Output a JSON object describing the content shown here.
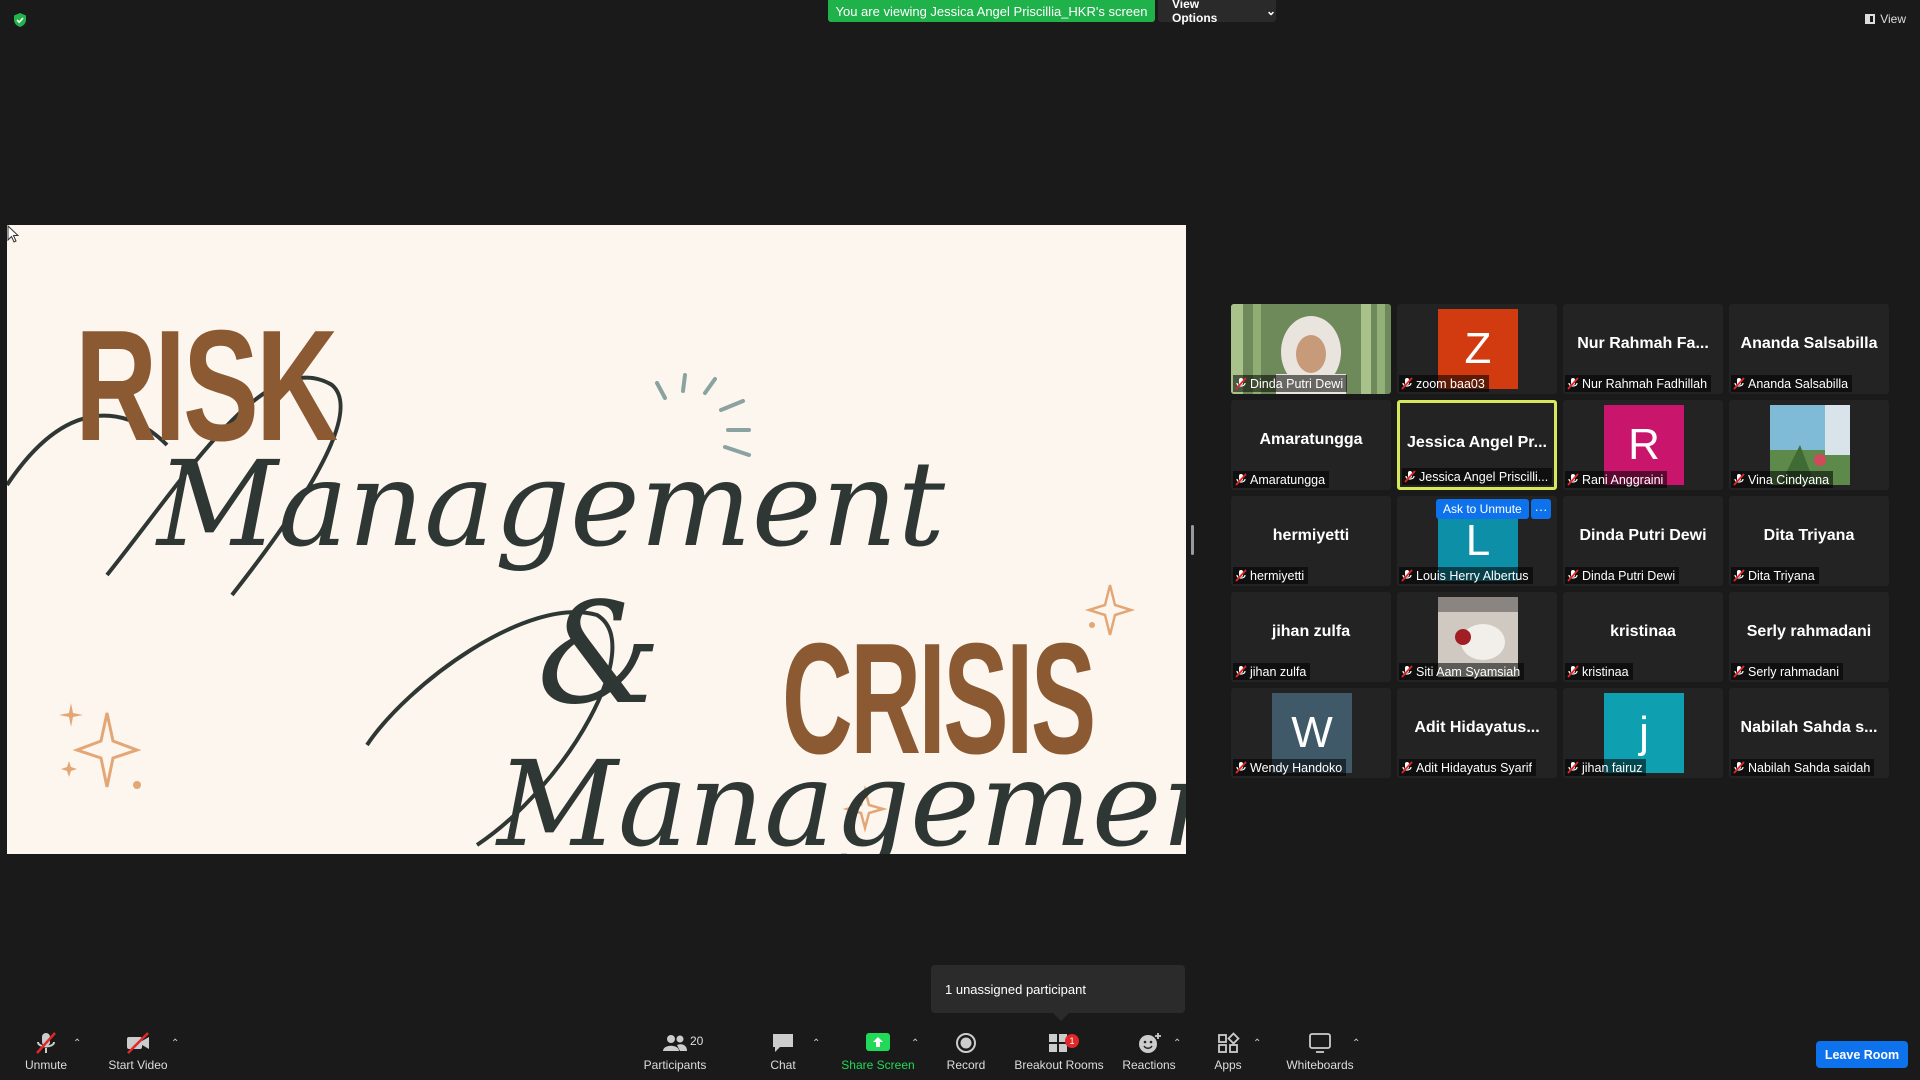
{
  "banner": {
    "viewing_text": "You are viewing Jessica Angel Priscillia_HKR's screen",
    "view_options": "View Options",
    "view": "View"
  },
  "slide": {
    "risk": "RISK",
    "management_1": "Management",
    "ampersand": "&",
    "crisis": "CRISIS",
    "management_2": "Management"
  },
  "tiles": [
    {
      "type": "photo",
      "label": "Dinda Putri Dewi"
    },
    {
      "type": "avatar",
      "letter": "Z",
      "color": "#d23b0f",
      "label": "zoom baa03"
    },
    {
      "type": "name",
      "center": "Nur Rahmah Fa...",
      "label": "Nur Rahmah Fadhillah"
    },
    {
      "type": "name",
      "center": "Ananda Salsabilla",
      "label": "Ananda Salsabilla"
    },
    {
      "type": "name",
      "center": "Amaratungga",
      "label": "Amaratungga"
    },
    {
      "type": "name",
      "center": "Jessica Angel Pr...",
      "label": "Jessica Angel Priscilli...",
      "active": true
    },
    {
      "type": "avatar",
      "letter": "R",
      "color": "#c9166c",
      "label": "Rani Anggraini"
    },
    {
      "type": "photo-sm",
      "label": "Vina Cindyana"
    },
    {
      "type": "name",
      "center": "hermiyetti",
      "label": "hermiyetti"
    },
    {
      "type": "avatar",
      "letter": "L",
      "color": "#0e8fa8",
      "label": "Louis Herry Albertus"
    },
    {
      "type": "name",
      "center": "Dinda Putri Dewi",
      "label": "Dinda Putri Dewi"
    },
    {
      "type": "name",
      "center": "Dita Triyana",
      "label": "Dita Triyana"
    },
    {
      "type": "name",
      "center": "jihan zulfa",
      "label": "jihan zulfa"
    },
    {
      "type": "photo-sm",
      "label": "Siti Aam Syamsiah"
    },
    {
      "type": "name",
      "center": "kristinaa",
      "label": "kristinaa"
    },
    {
      "type": "name",
      "center": "Serly rahmadani",
      "label": "Serly rahmadani"
    },
    {
      "type": "avatar",
      "letter": "W",
      "color": "#3f5968",
      "label": "Wendy Handoko"
    },
    {
      "type": "name",
      "center": "Adit  Hidayatus...",
      "label": "Adit Hidayatus Syarif"
    },
    {
      "type": "avatar",
      "letter": "j",
      "color": "#0ea0b0",
      "label": "jihan fairuz"
    },
    {
      "type": "name",
      "center": "Nabilah Sahda s...",
      "label": "Nabilah Sahda saidah"
    }
  ],
  "hover": {
    "ask_to_unmute": "Ask to Unmute",
    "more": "···"
  },
  "toast": "1 unassigned participant",
  "toolbar": {
    "unmute": "Unmute",
    "start_video": "Start Video",
    "participants": "Participants",
    "participants_count": "20",
    "chat": "Chat",
    "share_screen": "Share Screen",
    "record": "Record",
    "breakout_rooms": "Breakout Rooms",
    "breakout_badge": "1",
    "reactions": "Reactions",
    "apps": "Apps",
    "whiteboards": "Whiteboards",
    "leave_room": "Leave Room"
  },
  "colors": {
    "banner_green": "#1fb24b",
    "accent_blue": "#0e72ed",
    "active_speaker": "#d7e85a",
    "slide_brown": "#8b5a33",
    "slide_script": "#2e3733"
  }
}
